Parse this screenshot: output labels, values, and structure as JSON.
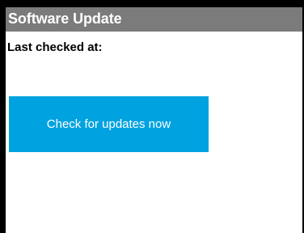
{
  "window": {
    "title": "Software Update"
  },
  "status": {
    "last_checked_label": "Last checked at:"
  },
  "actions": {
    "check_button_label": "Check for updates now"
  },
  "colors": {
    "titlebar_background": "#7b7b7b",
    "button_background": "#00a3e0",
    "frame": "#000000"
  }
}
